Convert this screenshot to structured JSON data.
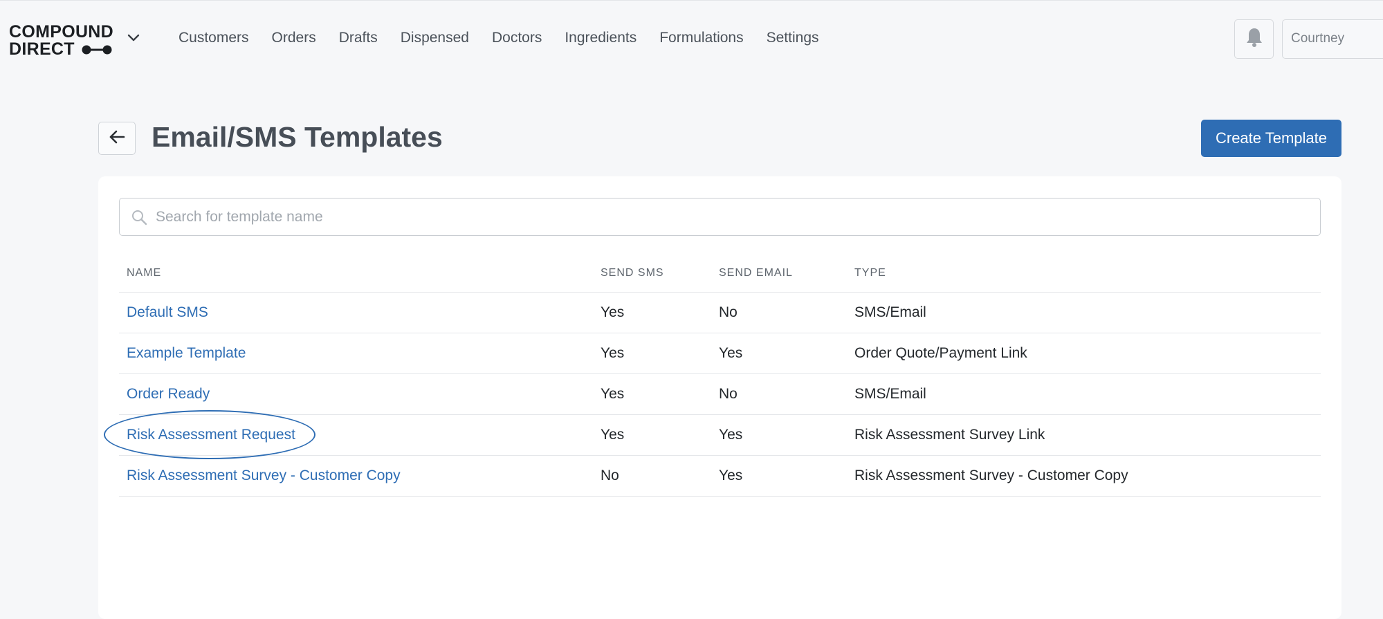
{
  "brand": {
    "line1": "COMPOUND",
    "line2": "DIRECT"
  },
  "nav": {
    "items": [
      {
        "label": "Customers"
      },
      {
        "label": "Orders"
      },
      {
        "label": "Drafts"
      },
      {
        "label": "Dispensed"
      },
      {
        "label": "Doctors"
      },
      {
        "label": "Ingredients"
      },
      {
        "label": "Formulations"
      },
      {
        "label": "Settings"
      }
    ]
  },
  "user": {
    "name": "Courtney"
  },
  "page": {
    "title": "Email/SMS Templates",
    "create_label": "Create Template"
  },
  "search": {
    "placeholder": "Search for template name",
    "value": ""
  },
  "table": {
    "columns": [
      "NAME",
      "SEND SMS",
      "SEND EMAIL",
      "TYPE"
    ],
    "rows": [
      {
        "name": "Default SMS",
        "send_sms": "Yes",
        "send_email": "No",
        "type": "SMS/Email"
      },
      {
        "name": "Example Template",
        "send_sms": "Yes",
        "send_email": "Yes",
        "type": "Order Quote/Payment Link"
      },
      {
        "name": "Order Ready",
        "send_sms": "Yes",
        "send_email": "No",
        "type": "SMS/Email"
      },
      {
        "name": "Risk Assessment Request",
        "send_sms": "Yes",
        "send_email": "Yes",
        "type": "Risk Assessment Survey Link"
      },
      {
        "name": "Risk Assessment Survey - Customer Copy",
        "send_sms": "No",
        "send_email": "Yes",
        "type": "Risk Assessment Survey - Customer Copy"
      }
    ]
  },
  "colors": {
    "accent": "#2e6db4",
    "background": "#f6f7f9",
    "highlight_ring": "#2e6db4"
  },
  "icons": {
    "brand_mark": "connector-dots-icon",
    "brand_menu": "chevron-down-icon",
    "notifications": "bell-icon",
    "back": "arrow-left-icon",
    "search": "search-icon"
  }
}
